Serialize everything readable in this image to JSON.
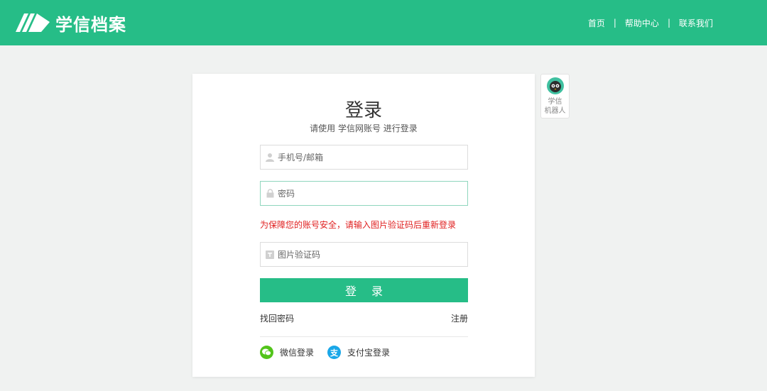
{
  "header": {
    "logo_text": "学信档案",
    "nav": [
      {
        "label": "首页"
      },
      {
        "label": "帮助中心"
      },
      {
        "label": "联系我们"
      }
    ],
    "separator": "|"
  },
  "login": {
    "title": "登录",
    "subtitle": "请使用 学信网账号 进行登录",
    "phone_placeholder": "手机号/邮箱",
    "password_placeholder": "密码",
    "warning": "为保障您的账号安全，请输入图片验证码后重新登录",
    "captcha_placeholder": "图片验证码",
    "submit_label": "登 录",
    "forgot_label": "找回密码",
    "register_label": "注册",
    "wechat_label": "微信登录",
    "alipay_label": "支付宝登录",
    "alipay_glyph": "支"
  },
  "robot": {
    "line1": "学信",
    "line2": "机器人"
  },
  "colors": {
    "brand": "#26bd87",
    "warning": "#e02020",
    "wechat": "#52c41a",
    "alipay": "#1aa7e8"
  }
}
